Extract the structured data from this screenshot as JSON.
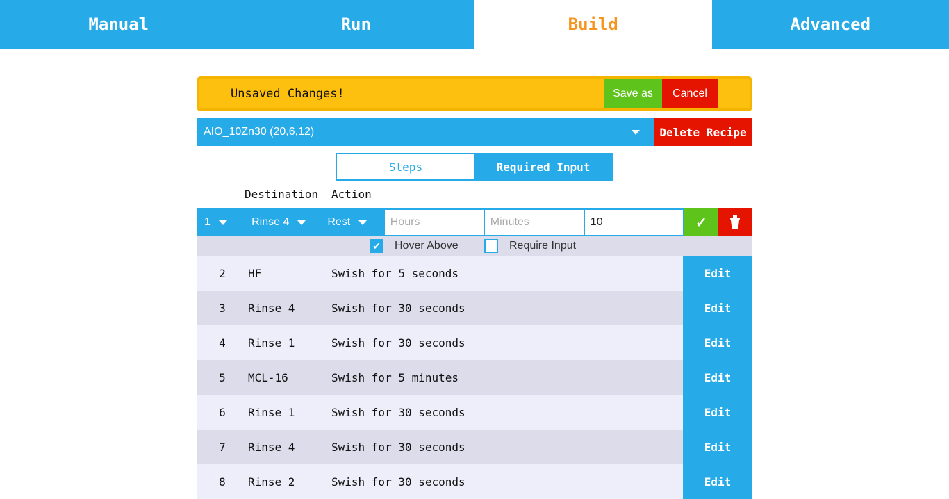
{
  "tabs": [
    "Manual",
    "Run",
    "Build",
    "Advanced"
  ],
  "banner": {
    "message": "Unsaved Changes!",
    "save_as": "Save as",
    "cancel": "Cancel"
  },
  "recipe": {
    "selected": "AIO_10Zn30 (20,6,12)",
    "delete": "Delete Recipe"
  },
  "toggle": {
    "steps": "Steps",
    "required_input": "Required Input"
  },
  "headers": {
    "destination": "Destination",
    "action": "Action"
  },
  "edit_step": {
    "number": "1",
    "destination": "Rinse 4",
    "action": "Rest",
    "hours_placeholder": "Hours",
    "minutes_placeholder": "Minutes",
    "seconds_value": "10",
    "hover_above": "Hover Above",
    "hover_above_checked": true,
    "require_input": "Require Input",
    "require_input_checked": false
  },
  "edit_label": "Edit",
  "steps": [
    {
      "n": "2",
      "dest": "HF",
      "action": "Swish for 5 seconds"
    },
    {
      "n": "3",
      "dest": "Rinse 4",
      "action": "Swish for 30 seconds"
    },
    {
      "n": "4",
      "dest": "Rinse 1",
      "action": "Swish for 30 seconds"
    },
    {
      "n": "5",
      "dest": "MCL-16",
      "action": "Swish for 5 minutes"
    },
    {
      "n": "6",
      "dest": "Rinse 1",
      "action": "Swish for 30 seconds"
    },
    {
      "n": "7",
      "dest": "Rinse 4",
      "action": "Swish for 30 seconds"
    },
    {
      "n": "8",
      "dest": "Rinse 2",
      "action": "Swish for 30 seconds"
    }
  ]
}
